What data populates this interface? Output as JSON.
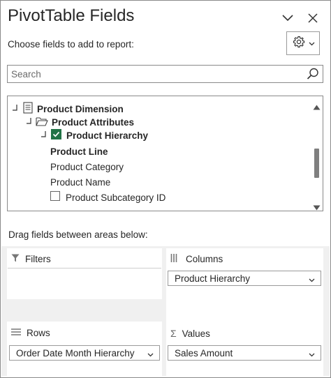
{
  "panel": {
    "title": "PivotTable Fields",
    "choose_label": "Choose fields to add to report:",
    "icons": [
      "chevron-down-icon",
      "close-icon",
      "gear-icon",
      "chevron-down-icon"
    ]
  },
  "search": {
    "placeholder": "Search",
    "value": ""
  },
  "field_list": {
    "items": [
      {
        "label": "Product Dimension",
        "bold": true,
        "icon": "table-icon",
        "expander": "collapse"
      },
      {
        "label": "Product Attributes",
        "bold": true,
        "icon": "folder-icon",
        "expander": "collapse"
      },
      {
        "label": "Product Hierarchy",
        "bold": true,
        "icon": "checkbox-checked",
        "checked": true,
        "expander": "collapse"
      },
      {
        "label": "Product Line",
        "bold": true
      },
      {
        "label": "Product Category",
        "bold": false
      },
      {
        "label": "Product Name",
        "bold": false
      },
      {
        "label": "Product Subcategory ID",
        "bold": false,
        "checked": false
      }
    ]
  },
  "areas": {
    "drag_label": "Drag fields between areas below:",
    "filters": {
      "label": "Filters",
      "icon": "filter-icon",
      "fields": []
    },
    "columns": {
      "label": "Columns",
      "icon": "columns-icon",
      "fields": [
        "Product Hierarchy"
      ]
    },
    "rows": {
      "label": "Rows",
      "icon": "rows-icon",
      "fields": [
        "Order Date Month Hierarchy"
      ]
    },
    "values": {
      "label": "Values",
      "icon": "sigma-icon",
      "fields": [
        "Sales Amount"
      ]
    }
  },
  "colors": {
    "check_green": "#217346",
    "border": "#8a8a8a",
    "area_bg": "#f0f0f0"
  }
}
